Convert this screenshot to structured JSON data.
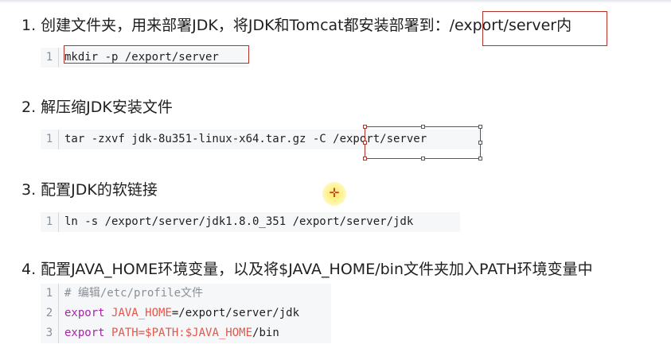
{
  "steps": [
    {
      "heading": "1. 创建文件夹，用来部署JDK，将JDK和Tomcat都安装部署到：/export/server内",
      "code": [
        {
          "num": "1",
          "text": "mkdir -p /export/server"
        }
      ]
    },
    {
      "heading": "2. 解压缩JDK安装文件",
      "code": [
        {
          "num": "1",
          "text": "tar -zxvf jdk-8u351-linux-x64.tar.gz -C /export/server"
        }
      ]
    },
    {
      "heading": "3. 配置JDK的软链接",
      "code": [
        {
          "num": "1",
          "text": "ln -s /export/server/jdk1.8.0_351 /export/server/jdk"
        }
      ]
    },
    {
      "heading": "4. 配置JAVA_HOME环境变量，以及将$JAVA_HOME/bin文件夹加入PATH环境变量中",
      "code": [
        {
          "num": "1",
          "comment": "# 编辑/etc/profile文件"
        },
        {
          "num": "2",
          "keyword": "export",
          "variable": "JAVA_HOME",
          "rest": "=/export/server/jdk"
        },
        {
          "num": "3",
          "keyword": "export",
          "variable": "PATH=$PATH:$JAVA_HOME",
          "rest": "/bin"
        }
      ]
    }
  ],
  "colors": {
    "annotation": "#b5322a",
    "code_background": "#f6f7f9",
    "keyword": "#a626a4",
    "variable": "#e45649",
    "comment": "#8a8f97",
    "cursor_highlight": "#ffec5a"
  },
  "icons": {
    "cursor": "crosshair-cursor-icon"
  }
}
